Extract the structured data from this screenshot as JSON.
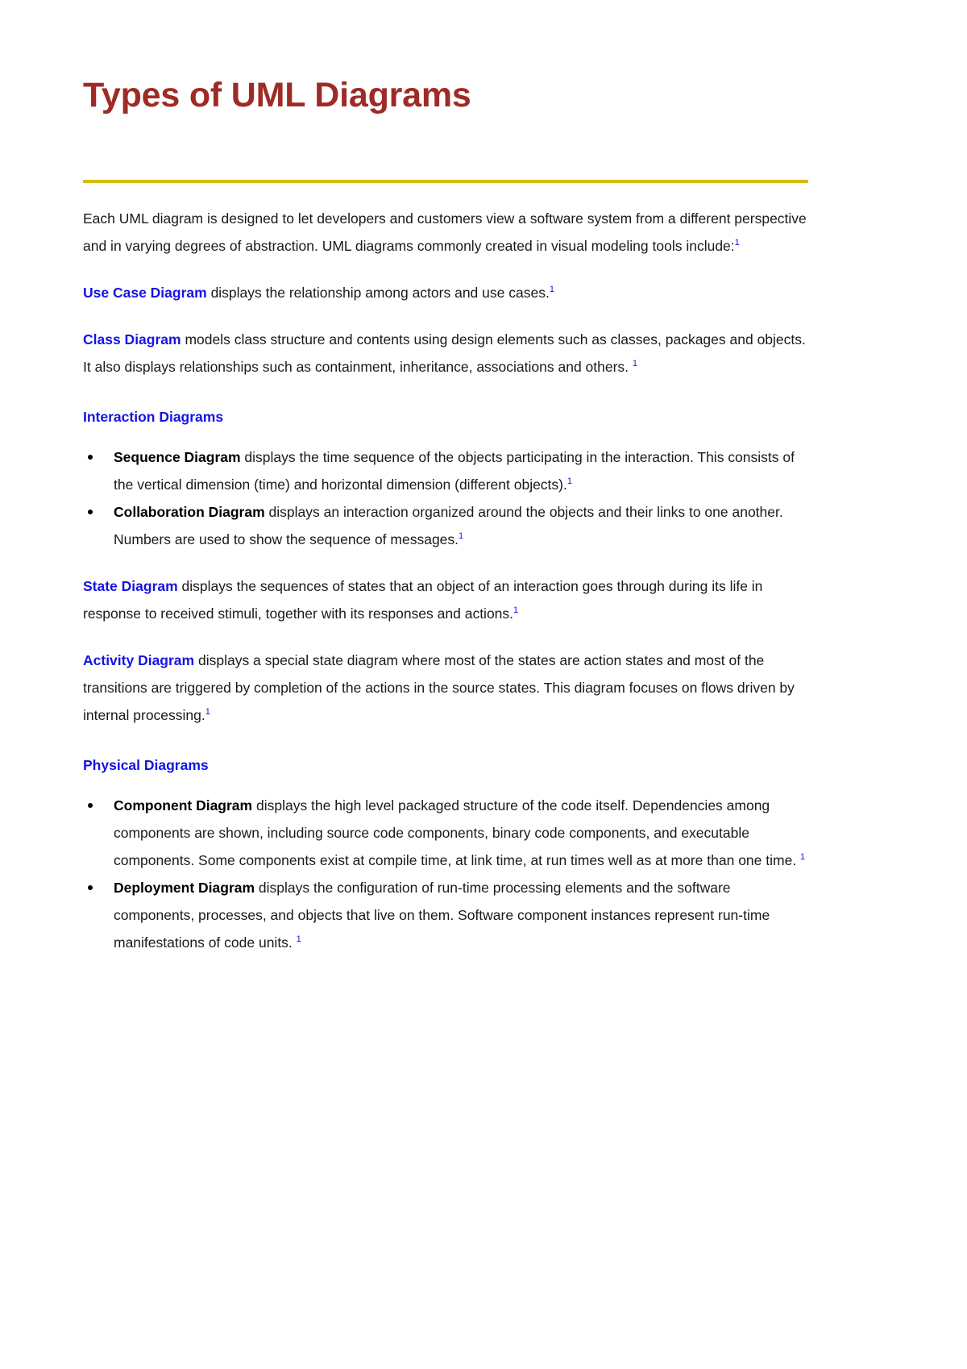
{
  "document": {
    "title": "Types of UML Diagrams",
    "title_color": "#9E2B25",
    "rule_color": "#D9BA09",
    "heading_color": "#1414E6",
    "footnote_mark": "1"
  },
  "intro": {
    "text": "Each UML diagram is designed to let developers and customers view a software system from a different perspective and in varying degrees of abstraction. UML diagrams commonly created in visual modeling tools include:"
  },
  "sections": [
    {
      "id": "use-case-diagram",
      "term": "Use Case Diagram",
      "term_style": "blue",
      "body": " displays the relationship among actors and use cases."
    },
    {
      "id": "class-diagram",
      "term": "Class Diagram",
      "term_style": "blue",
      "body": " models class structure and contents using design elements such as classes, packages and objects. It also displays relationships such as containment, inheritance, associations and others. "
    }
  ],
  "interaction": {
    "heading": "Interaction Diagrams",
    "items": [
      {
        "id": "sequence-diagram",
        "term": "Sequence Diagram",
        "body": " displays the time sequence of the objects participating in the interaction. This consists of the vertical dimension (time) and horizontal dimension (different objects)."
      },
      {
        "id": "collaboration-diagram",
        "term": "Collaboration Diagram",
        "body": " displays an interaction organized around the objects and their links to one another.   Numbers are used to show the sequence of messages."
      }
    ]
  },
  "state": {
    "id": "state-diagram",
    "term": "State Diagram",
    "body": " displays the sequences of states that an object of an interaction goes through during its life in response to received stimuli, together with its responses and actions."
  },
  "activity": {
    "id": "activity-diagram",
    "term": "Activity Diagram",
    "body": " displays a special state diagram where most of the states are action states and most of the transitions are triggered by completion of the actions in the source states. This diagram focuses on flows driven by internal processing."
  },
  "physical": {
    "heading": "Physical Diagrams",
    "items": [
      {
        "id": "component-diagram",
        "term": "Component Diagram",
        "body": " displays the high level packaged structure of the code itself. Dependencies among components are shown, including source code components, binary code components, and executable components.   Some components exist at compile time, at link time, at run times well as at more than one time. "
      },
      {
        "id": "deployment-diagram",
        "term": "Deployment Diagram",
        "body": " displays the configuration of run-time processing elements and the software components, processes, and objects that live on them.   Software component instances represent run-time manifestations of code units. "
      }
    ]
  }
}
